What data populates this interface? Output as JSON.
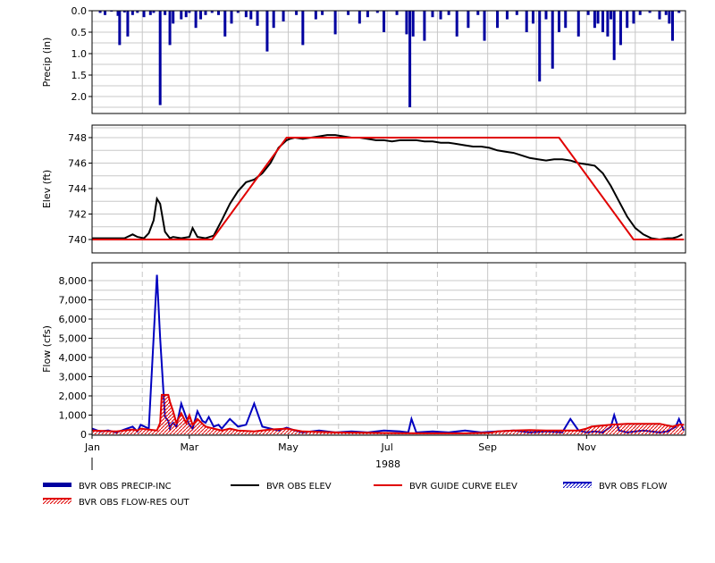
{
  "chart_data": [
    {
      "type": "bar",
      "panel": "precip",
      "ylabel": "Precip (in)",
      "ylim": [
        2.4,
        0
      ],
      "y_inverted": true,
      "yticks": [
        "0.0",
        "0.5",
        "1.0",
        "1.5",
        "2.0"
      ],
      "grid": true,
      "series": [
        {
          "name": "BVR OBS PRECIP-INC",
          "color": "#0000a0",
          "x_day": [
            5,
            8,
            12,
            16,
            17,
            20,
            22,
            25,
            28,
            32,
            36,
            38,
            42,
            45,
            48,
            50,
            55,
            58,
            60,
            64,
            67,
            70,
            74,
            78,
            82,
            86,
            90,
            95,
            98,
            102,
            108,
            112,
            118,
            126,
            130,
            138,
            142,
            150,
            158,
            165,
            170,
            176,
            180,
            188,
            194,
            196,
            198,
            205,
            210,
            215,
            220,
            225,
            232,
            238,
            242,
            250,
            256,
            262,
            268,
            272,
            276,
            280,
            284,
            288,
            292,
            300,
            306,
            310,
            312,
            315,
            318,
            320,
            322,
            326,
            330,
            334,
            338,
            344,
            350,
            354,
            356,
            358,
            362
          ],
          "values": [
            0.05,
            0.1,
            0.02,
            0.12,
            0.8,
            0.04,
            0.6,
            0.1,
            0.05,
            0.15,
            0.1,
            0.05,
            2.2,
            0.1,
            0.8,
            0.3,
            0.2,
            0.15,
            0.05,
            0.4,
            0.2,
            0.1,
            0.05,
            0.1,
            0.6,
            0.3,
            0.05,
            0.15,
            0.2,
            0.35,
            0.95,
            0.4,
            0.25,
            0.1,
            0.8,
            0.2,
            0.1,
            0.55,
            0.1,
            0.3,
            0.15,
            0.05,
            0.5,
            0.1,
            0.55,
            2.25,
            0.6,
            0.7,
            0.15,
            0.2,
            0.1,
            0.6,
            0.4,
            0.1,
            0.7,
            0.4,
            0.2,
            0.1,
            0.5,
            0.3,
            1.65,
            0.2,
            1.35,
            0.5,
            0.4,
            0.6,
            0.1,
            0.4,
            0.3,
            0.5,
            0.6,
            0.2,
            1.15,
            0.8,
            0.4,
            0.3,
            0.1,
            0.05,
            0.2,
            0.1,
            0.3,
            0.7,
            0.05
          ]
        }
      ]
    },
    {
      "type": "line",
      "panel": "elev",
      "ylabel": "Elev (ft)",
      "ylim": [
        739,
        749
      ],
      "yticks": [
        "740",
        "742",
        "744",
        "746",
        "748"
      ],
      "grid": true,
      "series": [
        {
          "name": "BVR OBS ELEV",
          "color": "#000000",
          "x_day": [
            0,
            10,
            15,
            20,
            25,
            28,
            32,
            35,
            38,
            40,
            42,
            45,
            48,
            50,
            55,
            60,
            62,
            65,
            70,
            75,
            80,
            85,
            90,
            95,
            100,
            105,
            110,
            115,
            120,
            122,
            125,
            130,
            135,
            140,
            145,
            150,
            155,
            160,
            165,
            170,
            175,
            180,
            185,
            190,
            195,
            200,
            205,
            210,
            215,
            220,
            225,
            230,
            235,
            240,
            245,
            250,
            255,
            260,
            265,
            270,
            275,
            280,
            285,
            290,
            295,
            300,
            305,
            310,
            315,
            320,
            325,
            330,
            335,
            340,
            345,
            350,
            355,
            358,
            361,
            364
          ],
          "values": [
            740.1,
            740.1,
            740.1,
            740.1,
            740.4,
            740.2,
            740.1,
            740.5,
            741.5,
            743.2,
            742.8,
            740.6,
            740.1,
            740.2,
            740.1,
            740.2,
            740.9,
            740.2,
            740.1,
            740.3,
            741.5,
            742.8,
            743.8,
            744.5,
            744.7,
            745.2,
            746.0,
            747.2,
            747.8,
            747.9,
            748.0,
            747.9,
            748.0,
            748.1,
            748.2,
            748.2,
            748.1,
            748.0,
            748.0,
            747.9,
            747.8,
            747.8,
            747.7,
            747.8,
            747.8,
            747.8,
            747.7,
            747.7,
            747.6,
            747.6,
            747.5,
            747.4,
            747.3,
            747.3,
            747.2,
            747.0,
            746.9,
            746.8,
            746.6,
            746.4,
            746.3,
            746.2,
            746.3,
            746.3,
            746.2,
            746.0,
            745.9,
            745.8,
            745.2,
            744.2,
            743.0,
            741.8,
            740.9,
            740.4,
            740.1,
            740.0,
            740.1,
            740.1,
            740.2,
            740.4
          ]
        },
        {
          "name": "BVR GUIDE CURVE ELEV",
          "color": "#e00000",
          "x_day": [
            0,
            74,
            120,
            288,
            334,
            365
          ],
          "values": [
            740.0,
            740.0,
            748.0,
            748.0,
            740.0,
            740.0
          ]
        }
      ]
    },
    {
      "type": "line",
      "panel": "flow",
      "xlabel": "1988",
      "ylabel": "Flow (cfs)",
      "ylim": [
        0,
        8800
      ],
      "yticks": [
        "0",
        "1,000",
        "2,000",
        "3,000",
        "4,000",
        "5,000",
        "6,000",
        "7,000",
        "8,000"
      ],
      "xticks": [
        "Jan",
        "Mar",
        "May",
        "Jul",
        "Sep",
        "Nov"
      ],
      "grid": true,
      "series": [
        {
          "name": "BVR OBS FLOW",
          "color": "#0000c0",
          "x_day": [
            0,
            5,
            10,
            15,
            20,
            25,
            28,
            30,
            35,
            40,
            42,
            45,
            47,
            48,
            49,
            50,
            52,
            55,
            58,
            60,
            62,
            65,
            68,
            70,
            72,
            75,
            78,
            80,
            85,
            90,
            95,
            100,
            105,
            110,
            115,
            120,
            125,
            130,
            140,
            150,
            160,
            170,
            180,
            190,
            195,
            197,
            200,
            210,
            220,
            230,
            240,
            250,
            260,
            270,
            280,
            290,
            295,
            300,
            305,
            310,
            315,
            320,
            322,
            325,
            330,
            340,
            350,
            355,
            360,
            362,
            365
          ],
          "values": [
            300,
            150,
            200,
            100,
            250,
            400,
            150,
            500,
            300,
            8300,
            5000,
            900,
            700,
            300,
            500,
            600,
            400,
            1600,
            900,
            500,
            300,
            1200,
            700,
            600,
            900,
            400,
            500,
            300,
            800,
            400,
            500,
            1600,
            400,
            300,
            200,
            350,
            200,
            100,
            200,
            100,
            150,
            100,
            200,
            150,
            100,
            800,
            100,
            150,
            100,
            200,
            100,
            150,
            200,
            100,
            150,
            100,
            800,
            200,
            100,
            150,
            100,
            400,
            1000,
            200,
            100,
            200,
            100,
            150,
            400,
            800,
            200
          ]
        },
        {
          "name": "BVR OBS FLOW-RES OUT",
          "color": "#e00000",
          "x_day": [
            0,
            15,
            25,
            28,
            30,
            40,
            42,
            43,
            47,
            48,
            50,
            52,
            55,
            58,
            60,
            62,
            65,
            70,
            75,
            80,
            85,
            90,
            100,
            110,
            120,
            130,
            150,
            170,
            190,
            210,
            230,
            245,
            250,
            260,
            270,
            280,
            290,
            300,
            305,
            308,
            320,
            330,
            340,
            344,
            350,
            358,
            362,
            365
          ],
          "values": [
            200,
            150,
            250,
            200,
            300,
            200,
            600,
            2050,
            2050,
            1700,
            1200,
            600,
            1100,
            600,
            1000,
            500,
            800,
            400,
            300,
            200,
            300,
            200,
            150,
            250,
            300,
            150,
            100,
            80,
            60,
            50,
            50,
            80,
            150,
            200,
            220,
            200,
            200,
            200,
            300,
            400,
            500,
            550,
            550,
            550,
            550,
            400,
            500,
            500
          ]
        }
      ]
    }
  ],
  "legend": [
    {
      "label": "BVR OBS PRECIP-INC",
      "swatch": "thick-line",
      "color": "#0000a0"
    },
    {
      "label": "BVR OBS ELEV",
      "swatch": "line",
      "color": "#000000"
    },
    {
      "label": "BVR GUIDE CURVE ELEV",
      "swatch": "line",
      "color": "#e00000"
    },
    {
      "label": "BVR OBS FLOW",
      "swatch": "hatch-blue",
      "color": "#0000c0"
    },
    {
      "label": "BVR OBS FLOW-RES OUT",
      "swatch": "hatch-red",
      "color": "#e00000"
    }
  ]
}
